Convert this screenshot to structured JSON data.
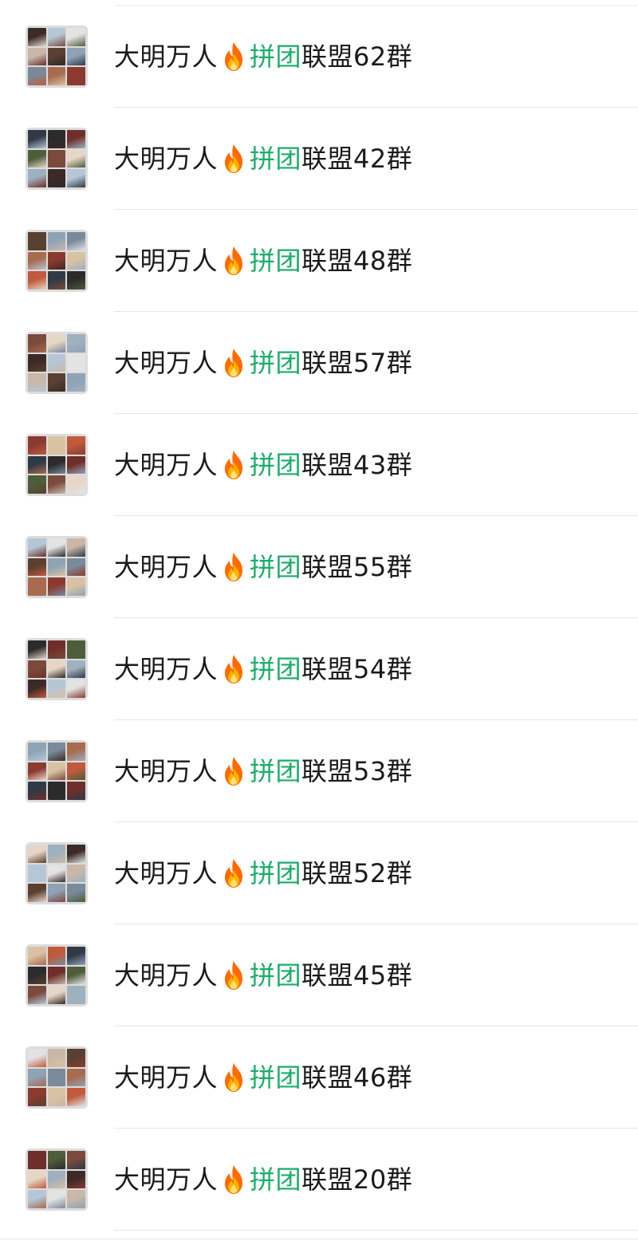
{
  "chats": [
    {
      "prefix": "大明万人",
      "green": "拼团",
      "suffix": "联盟62群"
    },
    {
      "prefix": "大明万人",
      "green": "拼团",
      "suffix": "联盟42群"
    },
    {
      "prefix": "大明万人",
      "green": "拼团",
      "suffix": "联盟48群"
    },
    {
      "prefix": "大明万人",
      "green": "拼团",
      "suffix": "联盟57群"
    },
    {
      "prefix": "大明万人",
      "green": "拼团",
      "suffix": "联盟43群"
    },
    {
      "prefix": "大明万人",
      "green": "拼团",
      "suffix": "联盟55群"
    },
    {
      "prefix": "大明万人",
      "green": "拼团",
      "suffix": "联盟54群"
    },
    {
      "prefix": "大明万人",
      "green": "拼团",
      "suffix": "联盟53群"
    },
    {
      "prefix": "大明万人",
      "green": "拼团",
      "suffix": "联盟52群"
    },
    {
      "prefix": "大明万人",
      "green": "拼团",
      "suffix": "联盟45群"
    },
    {
      "prefix": "大明万人",
      "green": "拼团",
      "suffix": "联盟46群"
    },
    {
      "prefix": "大明万人",
      "green": "拼团",
      "suffix": "联盟20群"
    }
  ],
  "icons": {
    "name_emoji": "fire-icon",
    "avatar": "group-avatar-grid"
  },
  "colors": {
    "highlight_text": "#1aad6b",
    "divider": "#e6e6e6",
    "fire": "#ff7a00"
  }
}
